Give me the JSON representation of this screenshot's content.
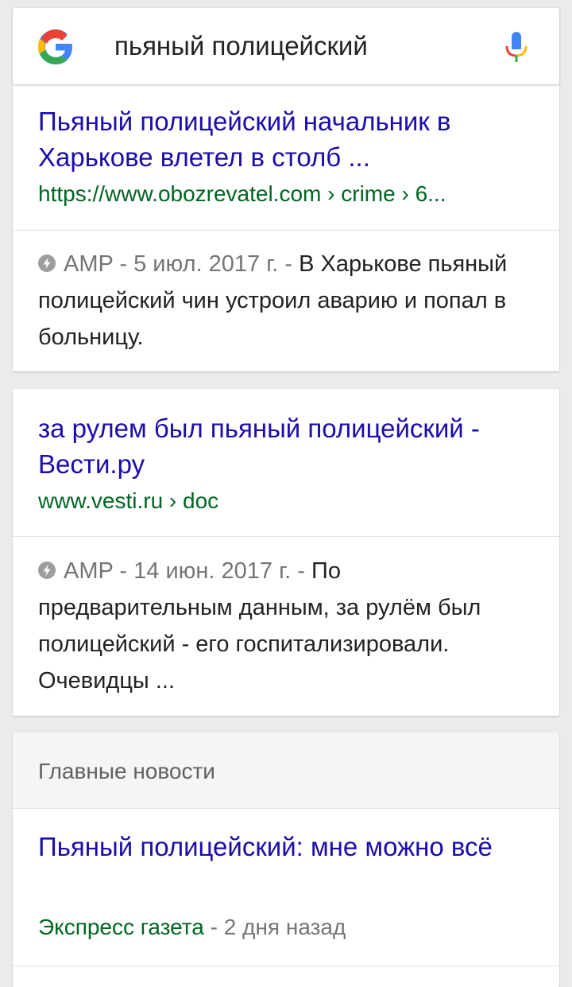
{
  "search": {
    "query": "пьяный полицейский"
  },
  "results": [
    {
      "title": "Пьяный полицейский начальник в Харькове влетел в столб ...",
      "url": "https://www.obozrevatel.com › crime › 6...",
      "amp_label": "AMP",
      "date": "5 июл. 2017 г.",
      "snippet": "В Харькове пьяный полицейский чин устроил аварию и попал в больницу."
    },
    {
      "title": "за рулем был пьяный полицейский - Вести.ру",
      "url": "www.vesti.ru › doc",
      "amp_label": "AMP",
      "date": "14 июн. 2017 г.",
      "snippet": "По предварительным данным, за рулём был полицейский - его госпитализировали. Очевидцы ..."
    }
  ],
  "top_stories": {
    "header": "Главные новости",
    "items": [
      {
        "title": "Пьяный полицейский: мне можно всё",
        "source": "Экспресс газета",
        "separator": "-",
        "ago": "2 дня назад"
      }
    ]
  },
  "separators": {
    "meta": "-"
  },
  "colors": {
    "title": "#1a0dab",
    "url": "#006621",
    "meta": "#757575",
    "background": "#ebebeb"
  },
  "icons": [
    "google-logo-icon",
    "microphone-icon",
    "amp-bolt-icon"
  ]
}
